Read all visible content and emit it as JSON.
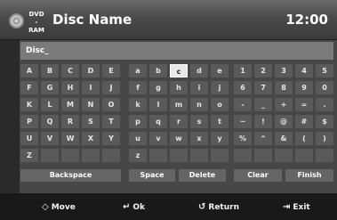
{
  "header": {
    "media_label_top": "DVD",
    "media_label_bottom": "-RAM",
    "title": "Disc Name",
    "clock": "12:00"
  },
  "input": {
    "value": "Disc_"
  },
  "keyboard": {
    "selected_key": "c",
    "groups": [
      [
        [
          "A",
          "B",
          "C",
          "D",
          "E"
        ],
        [
          "F",
          "G",
          "H",
          "I",
          "J"
        ],
        [
          "K",
          "L",
          "M",
          "N",
          "O"
        ],
        [
          "P",
          "Q",
          "R",
          "S",
          "T"
        ],
        [
          "U",
          "V",
          "W",
          "X",
          "Y"
        ],
        [
          "Z",
          "",
          "",
          "",
          ""
        ]
      ],
      [
        [
          "a",
          "b",
          "c",
          "d",
          "e"
        ],
        [
          "f",
          "g",
          "h",
          "i",
          "j"
        ],
        [
          "k",
          "l",
          "m",
          "n",
          "o"
        ],
        [
          "p",
          "q",
          "r",
          "s",
          "t"
        ],
        [
          "u",
          "v",
          "w",
          "x",
          "y"
        ],
        [
          "z",
          "",
          "",
          "",
          ""
        ]
      ],
      [
        [
          "1",
          "2",
          "3",
          "4",
          "5"
        ],
        [
          "6",
          "7",
          "8",
          "9",
          "0"
        ],
        [
          "-",
          "_",
          "+",
          "=",
          "."
        ],
        [
          "~",
          "!",
          "@",
          "#",
          "$"
        ],
        [
          "%",
          "^",
          "&",
          "(",
          ")"
        ],
        [
          "",
          "",
          "",
          "",
          ""
        ]
      ]
    ]
  },
  "function_keys": {
    "backspace": "Backspace",
    "space": "Space",
    "delete": "Delete",
    "clear": "Clear",
    "finish": "Finish"
  },
  "footer": {
    "move": {
      "icon": "move-arrows-icon",
      "glyph": "◇",
      "label": "Move"
    },
    "ok": {
      "icon": "enter-icon",
      "glyph": "↵",
      "label": "Ok"
    },
    "return": {
      "icon": "return-arrow-icon",
      "glyph": "↺",
      "label": "Return"
    },
    "exit": {
      "icon": "exit-door-icon",
      "glyph": "⇥",
      "label": "Exit"
    }
  }
}
